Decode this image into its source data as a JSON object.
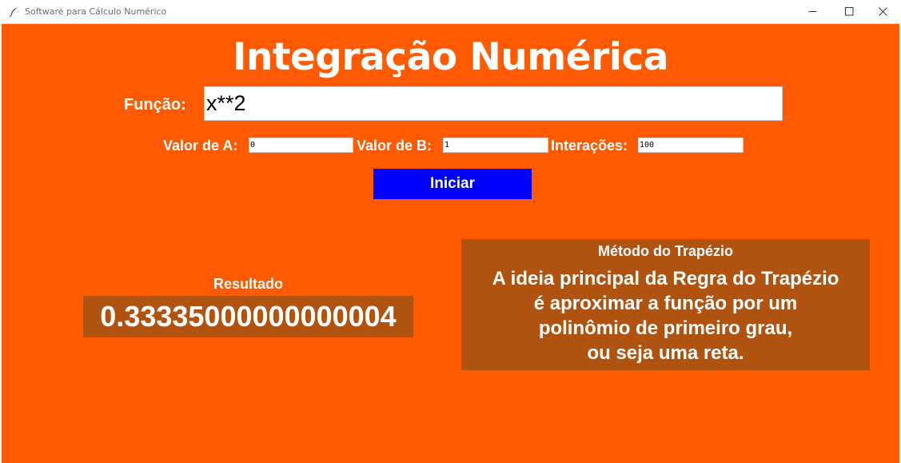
{
  "window": {
    "title": "Software para Cálculo Numérico",
    "icons": {
      "app": "feather-icon",
      "minimize": "minimize-icon",
      "maximize": "maximize-icon",
      "close": "close-icon"
    }
  },
  "main": {
    "heading": "Integração Numérica",
    "function_label": "Função:",
    "function_value": "x**2",
    "a_label": "Valor de A:",
    "a_value": "0",
    "b_label": "Valor de B:",
    "b_value": "1",
    "iterations_label": "Interações:",
    "iterations_value": "100",
    "start_button": "Iniciar"
  },
  "result": {
    "label": "Resultado",
    "value": "0.33335000000000004"
  },
  "method": {
    "title": "Método do Trapézio",
    "lines": [
      "A ideia principal da Regra do Trapézio",
      "é aproximar a função por um",
      "polinômio de primeiro grau,",
      "ou seja uma reta."
    ]
  },
  "colors": {
    "background": "#ff5a00",
    "panel": "#b05310",
    "button": "#0000ff",
    "text": "#ffffff"
  }
}
